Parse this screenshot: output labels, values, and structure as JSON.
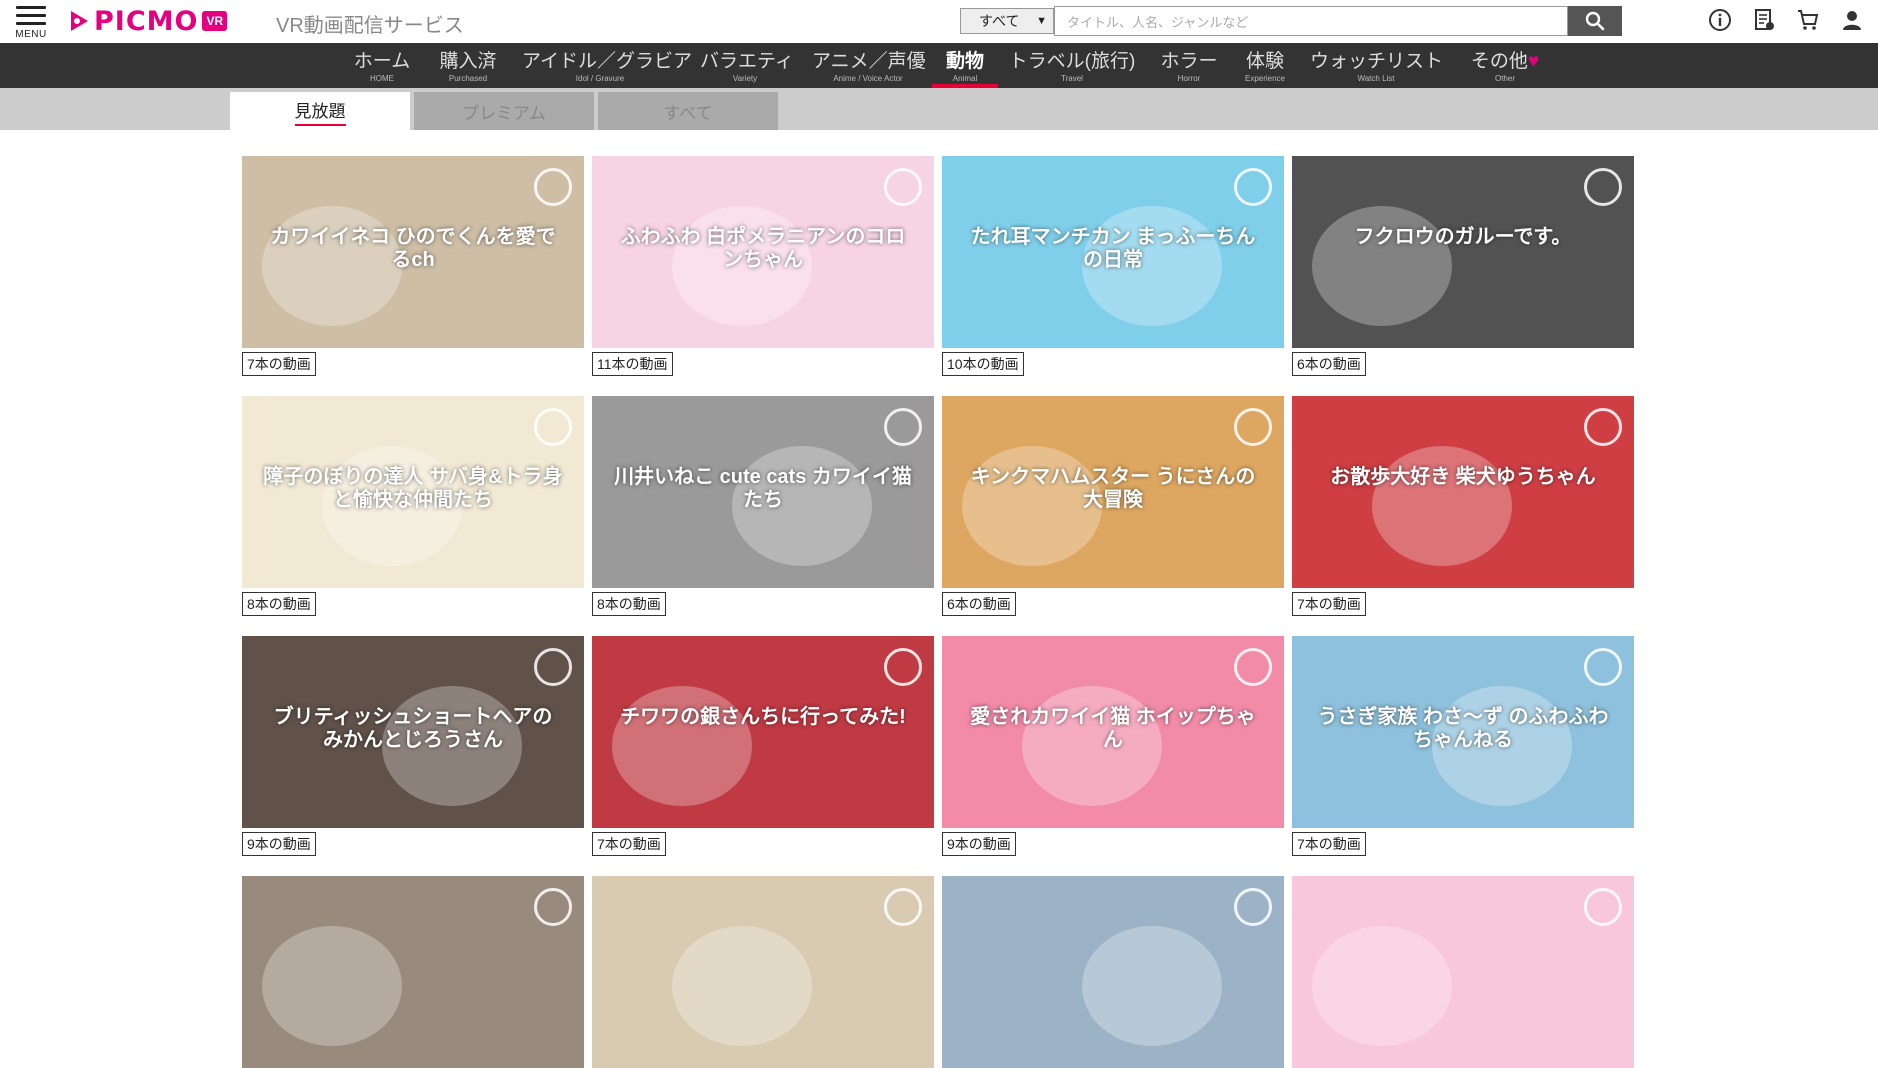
{
  "header": {
    "menu_label": "MENU",
    "logo_text": "PICMO",
    "logo_badge": "VR",
    "service_name": "VR動画配信サービス",
    "search_scope": "すべて",
    "search_placeholder": "タイトル、人名、ジャンルなど",
    "icons": [
      "info-icon",
      "history-icon",
      "cart-icon",
      "user-icon"
    ]
  },
  "nav": [
    {
      "jp": "ホーム",
      "en": "HOME"
    },
    {
      "jp": "購入済",
      "en": "Purchased"
    },
    {
      "jp": "アイドル／グラビア",
      "en": "Idol / Gravure"
    },
    {
      "jp": "バラエティ",
      "en": "Variety"
    },
    {
      "jp": "アニメ／声優",
      "en": "Anime / Voice Actor"
    },
    {
      "jp": "動物",
      "en": "Animal",
      "active": true
    },
    {
      "jp": "トラベル(旅行)",
      "en": "Travel"
    },
    {
      "jp": "ホラー",
      "en": "Horror"
    },
    {
      "jp": "体験",
      "en": "Experience"
    },
    {
      "jp": "ウォッチリスト",
      "en": "Watch List"
    },
    {
      "jp": "その他",
      "en": "Other"
    }
  ],
  "tabs": [
    {
      "label": "見放題",
      "active": true
    },
    {
      "label": "プレミアム"
    },
    {
      "label": "すべて"
    }
  ],
  "channels": [
    {
      "title": "カワイイネコ ひのでくんを愛でるch",
      "count": "7本の動画",
      "bg": "#c8b59a"
    },
    {
      "title": "ふわふわ 白ポメラニアンのコロンちゃん",
      "count": "11本の動画",
      "bg": "#f6cfe0"
    },
    {
      "title": "たれ耳マンチカン まっふーちんの日常",
      "count": "10本の動画",
      "bg": "#6fc9e8"
    },
    {
      "title": "フクロウのガルーです。",
      "count": "6本の動画",
      "bg": "#3b3b3b"
    },
    {
      "title": "障子のぼりの達人 サバ身&トラ身と愉快な仲間たち",
      "count": "8本の動画",
      "bg": "#efe6cf"
    },
    {
      "title": "川井いねこ cute cats カワイイ猫たち",
      "count": "8本の動画",
      "bg": "#8c8c8c"
    },
    {
      "title": "キンクマハムスター うにさんの大冒険",
      "count": "6本の動画",
      "bg": "#d99b4c"
    },
    {
      "title": "お散歩大好き 柴犬ゆうちゃん",
      "count": "7本の動画",
      "bg": "#c8242a"
    },
    {
      "title": "ブリティッシュショートヘアの みかんとじろうさん",
      "count": "9本の動画",
      "bg": "#4a3a30"
    },
    {
      "title": "チワワの銀さんちに行ってみた!",
      "count": "7本の動画",
      "bg": "#b81f2a"
    },
    {
      "title": "愛されカワイイ猫 ホイップちゃん",
      "count": "9本の動画",
      "bg": "#f07c9c"
    },
    {
      "title": "うさぎ家族 わさ～ず のふわふわちゃんねる",
      "count": "7本の動画",
      "bg": "#7fb9d9"
    },
    {
      "title": "",
      "count": "",
      "bg": "#8a7a6a"
    },
    {
      "title": "",
      "count": "",
      "bg": "#d3c4a8"
    },
    {
      "title": "",
      "count": "",
      "bg": "#8fa9c0"
    },
    {
      "title": "",
      "count": "",
      "bg": "#f7c0d6"
    }
  ]
}
